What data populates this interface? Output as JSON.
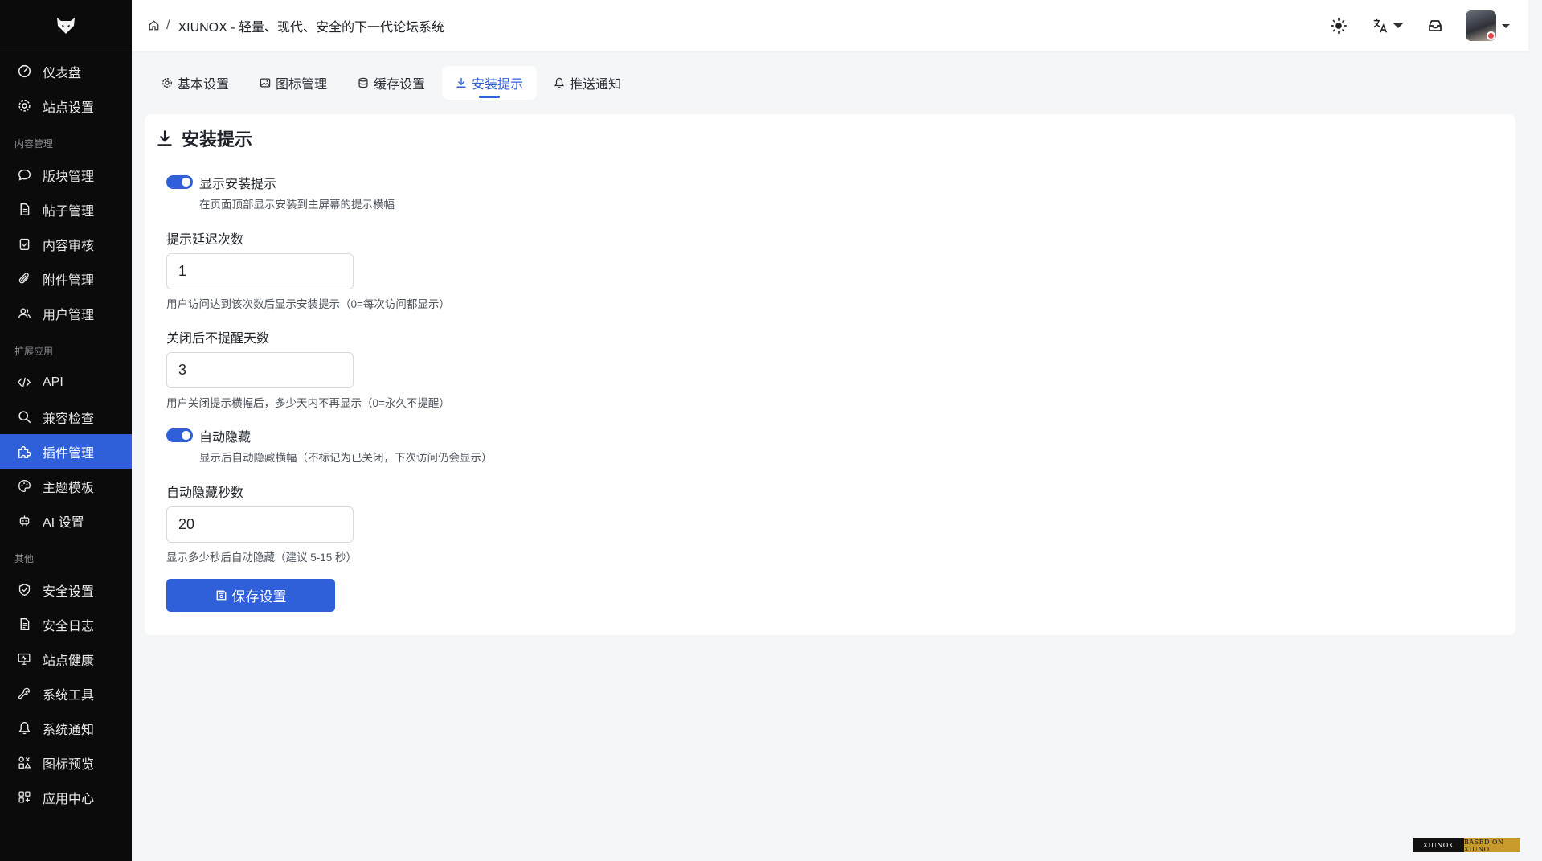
{
  "sidebar": {
    "top_items": [
      {
        "label": "仪表盘",
        "icon": "dashboard-icon"
      },
      {
        "label": "站点设置",
        "icon": "gear-icon"
      }
    ],
    "sections": [
      {
        "title": "内容管理",
        "items": [
          {
            "label": "版块管理",
            "icon": "chat-bubble-icon"
          },
          {
            "label": "帖子管理",
            "icon": "document-icon"
          },
          {
            "label": "内容审核",
            "icon": "clipboard-check-icon"
          },
          {
            "label": "附件管理",
            "icon": "paperclip-icon"
          },
          {
            "label": "用户管理",
            "icon": "users-icon"
          }
        ]
      },
      {
        "title": "扩展应用",
        "items": [
          {
            "label": "API",
            "icon": "code-icon"
          },
          {
            "label": "兼容检查",
            "icon": "search-icon"
          },
          {
            "label": "插件管理",
            "icon": "puzzle-icon",
            "active": true
          },
          {
            "label": "主题模板",
            "icon": "palette-icon"
          },
          {
            "label": "AI 设置",
            "icon": "robot-icon"
          }
        ]
      },
      {
        "title": "其他",
        "items": [
          {
            "label": "安全设置",
            "icon": "shield-icon"
          },
          {
            "label": "安全日志",
            "icon": "log-document-icon"
          },
          {
            "label": "站点健康",
            "icon": "monitor-icon"
          },
          {
            "label": "系统工具",
            "icon": "wrench-icon"
          },
          {
            "label": "系统通知",
            "icon": "bell-icon"
          },
          {
            "label": "图标预览",
            "icon": "shapes-icon"
          },
          {
            "label": "应用中心",
            "icon": "apps-grid-icon"
          }
        ]
      }
    ]
  },
  "header": {
    "breadcrumb_separator": "/",
    "site_title": "XIUNOX - 轻量、现代、安全的下一代论坛系统"
  },
  "tabs": [
    {
      "label": "基本设置",
      "icon": "gear-icon"
    },
    {
      "label": "图标管理",
      "icon": "image-icon"
    },
    {
      "label": "缓存设置",
      "icon": "database-icon"
    },
    {
      "label": "安装提示",
      "icon": "download-icon",
      "active": true
    },
    {
      "label": "推送通知",
      "icon": "bell-icon"
    }
  ],
  "panel": {
    "title": "安装提示",
    "show_prompt": {
      "label": "显示安装提示",
      "hint": "在页面顶部显示安装到主屏幕的提示横幅",
      "enabled": true
    },
    "delay_count": {
      "label": "提示延迟次数",
      "value": "1",
      "hint": "用户访问达到该次数后显示安装提示（0=每次访问都显示）"
    },
    "dismiss_days": {
      "label": "关闭后不提醒天数",
      "value": "3",
      "hint": "用户关闭提示横幅后，多少天内不再显示（0=永久不提醒）"
    },
    "auto_hide": {
      "label": "自动隐藏",
      "hint": "显示后自动隐藏横幅（不标记为已关闭，下次访问仍会显示）",
      "enabled": true
    },
    "auto_hide_seconds": {
      "label": "自动隐藏秒数",
      "value": "20",
      "hint": "显示多少秒后自动隐藏（建议 5-15 秒）"
    },
    "save_label": "保存设置"
  },
  "footer_badge": {
    "left": "XIUNOX",
    "right": "BASED ON XIUNO"
  },
  "colors": {
    "accent": "#2f5fd9",
    "sidebar_bg": "#0b0b0c",
    "page_bg": "#f5f6f8"
  }
}
